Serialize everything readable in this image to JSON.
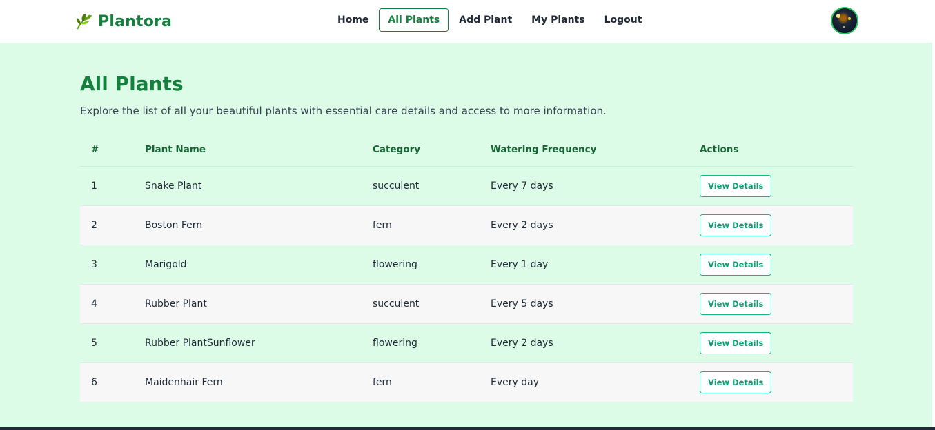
{
  "brand": {
    "name": "Plantora",
    "icon": "leaf-icon"
  },
  "nav": {
    "items": [
      {
        "label": "Home",
        "active": false
      },
      {
        "label": "All Plants",
        "active": true
      },
      {
        "label": "Add Plant",
        "active": false
      },
      {
        "label": "My Plants",
        "active": false
      },
      {
        "label": "Logout",
        "active": false
      }
    ]
  },
  "user": {
    "avatar": "avatar-image"
  },
  "page": {
    "title": "All Plants",
    "subtitle": "Explore the list of all your beautiful plants with essential care details and access to more information."
  },
  "table": {
    "headers": [
      "#",
      "Plant Name",
      "Category",
      "Watering Frequency",
      "Actions"
    ],
    "rows": [
      {
        "num": "1",
        "name": "Snake Plant",
        "category": "succulent",
        "watering": "Every 7 days",
        "action": "View Details"
      },
      {
        "num": "2",
        "name": "Boston Fern",
        "category": "fern",
        "watering": "Every 2 days",
        "action": "View Details"
      },
      {
        "num": "3",
        "name": "Marigold",
        "category": "flowering",
        "watering": "Every 1 day",
        "action": "View Details"
      },
      {
        "num": "4",
        "name": "Rubber Plant",
        "category": "succulent",
        "watering": "Every 5 days",
        "action": "View Details"
      },
      {
        "num": "5",
        "name": "Rubber PlantSunflower",
        "category": "flowering",
        "watering": "Every 2 days",
        "action": "View Details"
      },
      {
        "num": "6",
        "name": "Maidenhair Fern",
        "category": "fern",
        "watering": "Every day",
        "action": "View Details"
      }
    ]
  },
  "colors": {
    "brand": "#15803d",
    "page_bg": "#dcfce7",
    "button_accent": "#10b981"
  }
}
